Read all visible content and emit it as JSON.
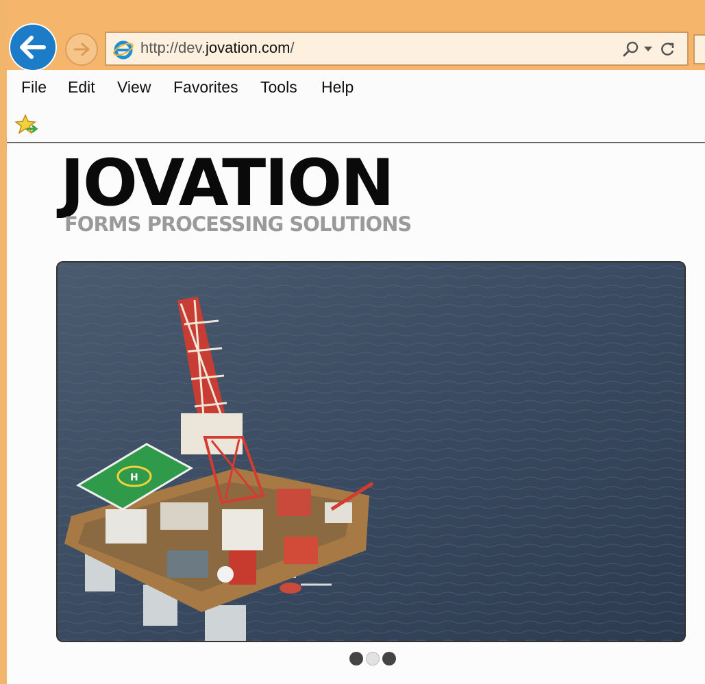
{
  "browser": {
    "address_prefix": "http://dev.",
    "address_domain": "jovation.com",
    "address_suffix": "/",
    "icons": [
      "back-arrow-icon",
      "forward-arrow-icon",
      "ie-logo-icon",
      "search-icon",
      "dropdown-icon",
      "refresh-icon",
      "favorites-star-icon"
    ]
  },
  "menu": {
    "items": [
      "File",
      "Edit",
      "View",
      "Favorites",
      "Tools",
      "Help"
    ]
  },
  "page": {
    "logo_title": "JOVATION",
    "logo_tagline": "FORMS PROCESSING SOLUTIONS",
    "slider_image": "offshore oil rig with helipad at sea",
    "slider_dots": {
      "count": 3,
      "active_index": 1
    }
  },
  "colors": {
    "chrome": "#f5b56a",
    "back_button": "#1c7cc8",
    "sea": "#3e4d61",
    "helipad": "#2f9a4a"
  }
}
